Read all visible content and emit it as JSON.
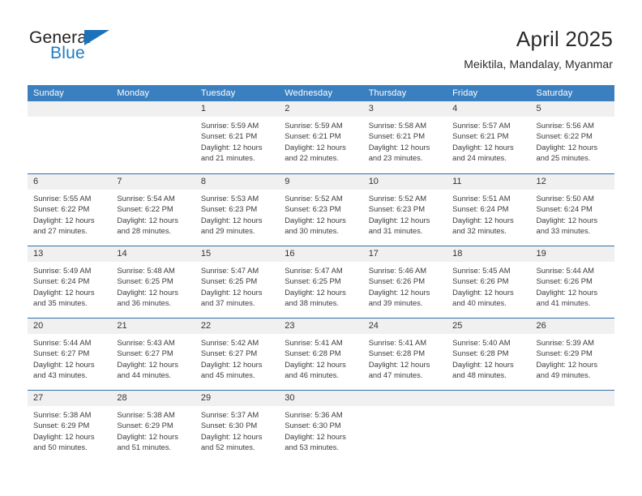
{
  "brand": {
    "name_top": "General",
    "name_bottom": "Blue",
    "accent_color": "#1b72b8"
  },
  "header": {
    "title": "April 2025",
    "subtitle": "Meiktila, Mandalay, Myanmar"
  },
  "calendar": {
    "header_bg": "#3a7fbf",
    "band_bg": "#f0f0f0",
    "row_border": "#2f6fab",
    "weekdays": [
      "Sunday",
      "Monday",
      "Tuesday",
      "Wednesday",
      "Thursday",
      "Friday",
      "Saturday"
    ],
    "weeks": [
      [
        {
          "day": "",
          "lines": []
        },
        {
          "day": "",
          "lines": []
        },
        {
          "day": "1",
          "lines": [
            "Sunrise: 5:59 AM",
            "Sunset: 6:21 PM",
            "Daylight: 12 hours",
            "and 21 minutes."
          ]
        },
        {
          "day": "2",
          "lines": [
            "Sunrise: 5:59 AM",
            "Sunset: 6:21 PM",
            "Daylight: 12 hours",
            "and 22 minutes."
          ]
        },
        {
          "day": "3",
          "lines": [
            "Sunrise: 5:58 AM",
            "Sunset: 6:21 PM",
            "Daylight: 12 hours",
            "and 23 minutes."
          ]
        },
        {
          "day": "4",
          "lines": [
            "Sunrise: 5:57 AM",
            "Sunset: 6:21 PM",
            "Daylight: 12 hours",
            "and 24 minutes."
          ]
        },
        {
          "day": "5",
          "lines": [
            "Sunrise: 5:56 AM",
            "Sunset: 6:22 PM",
            "Daylight: 12 hours",
            "and 25 minutes."
          ]
        }
      ],
      [
        {
          "day": "6",
          "lines": [
            "Sunrise: 5:55 AM",
            "Sunset: 6:22 PM",
            "Daylight: 12 hours",
            "and 27 minutes."
          ]
        },
        {
          "day": "7",
          "lines": [
            "Sunrise: 5:54 AM",
            "Sunset: 6:22 PM",
            "Daylight: 12 hours",
            "and 28 minutes."
          ]
        },
        {
          "day": "8",
          "lines": [
            "Sunrise: 5:53 AM",
            "Sunset: 6:23 PM",
            "Daylight: 12 hours",
            "and 29 minutes."
          ]
        },
        {
          "day": "9",
          "lines": [
            "Sunrise: 5:52 AM",
            "Sunset: 6:23 PM",
            "Daylight: 12 hours",
            "and 30 minutes."
          ]
        },
        {
          "day": "10",
          "lines": [
            "Sunrise: 5:52 AM",
            "Sunset: 6:23 PM",
            "Daylight: 12 hours",
            "and 31 minutes."
          ]
        },
        {
          "day": "11",
          "lines": [
            "Sunrise: 5:51 AM",
            "Sunset: 6:24 PM",
            "Daylight: 12 hours",
            "and 32 minutes."
          ]
        },
        {
          "day": "12",
          "lines": [
            "Sunrise: 5:50 AM",
            "Sunset: 6:24 PM",
            "Daylight: 12 hours",
            "and 33 minutes."
          ]
        }
      ],
      [
        {
          "day": "13",
          "lines": [
            "Sunrise: 5:49 AM",
            "Sunset: 6:24 PM",
            "Daylight: 12 hours",
            "and 35 minutes."
          ]
        },
        {
          "day": "14",
          "lines": [
            "Sunrise: 5:48 AM",
            "Sunset: 6:25 PM",
            "Daylight: 12 hours",
            "and 36 minutes."
          ]
        },
        {
          "day": "15",
          "lines": [
            "Sunrise: 5:47 AM",
            "Sunset: 6:25 PM",
            "Daylight: 12 hours",
            "and 37 minutes."
          ]
        },
        {
          "day": "16",
          "lines": [
            "Sunrise: 5:47 AM",
            "Sunset: 6:25 PM",
            "Daylight: 12 hours",
            "and 38 minutes."
          ]
        },
        {
          "day": "17",
          "lines": [
            "Sunrise: 5:46 AM",
            "Sunset: 6:26 PM",
            "Daylight: 12 hours",
            "and 39 minutes."
          ]
        },
        {
          "day": "18",
          "lines": [
            "Sunrise: 5:45 AM",
            "Sunset: 6:26 PM",
            "Daylight: 12 hours",
            "and 40 minutes."
          ]
        },
        {
          "day": "19",
          "lines": [
            "Sunrise: 5:44 AM",
            "Sunset: 6:26 PM",
            "Daylight: 12 hours",
            "and 41 minutes."
          ]
        }
      ],
      [
        {
          "day": "20",
          "lines": [
            "Sunrise: 5:44 AM",
            "Sunset: 6:27 PM",
            "Daylight: 12 hours",
            "and 43 minutes."
          ]
        },
        {
          "day": "21",
          "lines": [
            "Sunrise: 5:43 AM",
            "Sunset: 6:27 PM",
            "Daylight: 12 hours",
            "and 44 minutes."
          ]
        },
        {
          "day": "22",
          "lines": [
            "Sunrise: 5:42 AM",
            "Sunset: 6:27 PM",
            "Daylight: 12 hours",
            "and 45 minutes."
          ]
        },
        {
          "day": "23",
          "lines": [
            "Sunrise: 5:41 AM",
            "Sunset: 6:28 PM",
            "Daylight: 12 hours",
            "and 46 minutes."
          ]
        },
        {
          "day": "24",
          "lines": [
            "Sunrise: 5:41 AM",
            "Sunset: 6:28 PM",
            "Daylight: 12 hours",
            "and 47 minutes."
          ]
        },
        {
          "day": "25",
          "lines": [
            "Sunrise: 5:40 AM",
            "Sunset: 6:28 PM",
            "Daylight: 12 hours",
            "and 48 minutes."
          ]
        },
        {
          "day": "26",
          "lines": [
            "Sunrise: 5:39 AM",
            "Sunset: 6:29 PM",
            "Daylight: 12 hours",
            "and 49 minutes."
          ]
        }
      ],
      [
        {
          "day": "27",
          "lines": [
            "Sunrise: 5:38 AM",
            "Sunset: 6:29 PM",
            "Daylight: 12 hours",
            "and 50 minutes."
          ]
        },
        {
          "day": "28",
          "lines": [
            "Sunrise: 5:38 AM",
            "Sunset: 6:29 PM",
            "Daylight: 12 hours",
            "and 51 minutes."
          ]
        },
        {
          "day": "29",
          "lines": [
            "Sunrise: 5:37 AM",
            "Sunset: 6:30 PM",
            "Daylight: 12 hours",
            "and 52 minutes."
          ]
        },
        {
          "day": "30",
          "lines": [
            "Sunrise: 5:36 AM",
            "Sunset: 6:30 PM",
            "Daylight: 12 hours",
            "and 53 minutes."
          ]
        },
        {
          "day": "",
          "lines": []
        },
        {
          "day": "",
          "lines": []
        },
        {
          "day": "",
          "lines": []
        }
      ]
    ]
  }
}
